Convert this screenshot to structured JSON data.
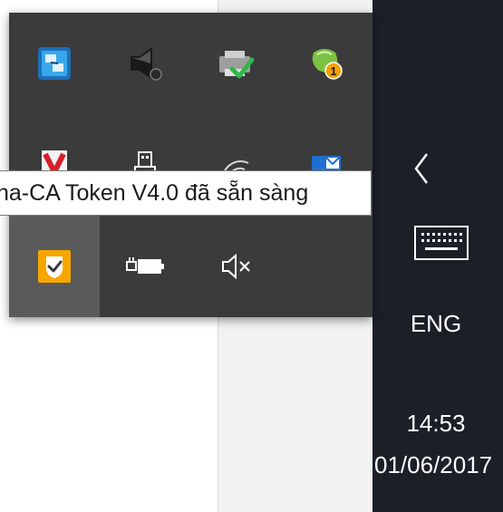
{
  "tooltip": {
    "text": "na-CA Token V4.0 đã sẵn sàng"
  },
  "tray": {
    "icons": [
      {
        "name": "network-monitor-icon",
        "color": "#2a8fd8"
      },
      {
        "name": "speaker-app-icon",
        "color": "#222222"
      },
      {
        "name": "printer-check-icon",
        "color": "#4caf50"
      },
      {
        "name": "notification-badge-icon",
        "badge": "1",
        "color": "#f5a300"
      },
      {
        "name": "antivirus-v-icon",
        "color": "#d81e2c"
      },
      {
        "name": "usb-device-icon",
        "color": "#ffffff"
      },
      {
        "name": "wifi-icon",
        "color": "#ffffff"
      },
      {
        "name": "outlook-icon",
        "color": "#1f6fd0"
      },
      {
        "name": "security-shield-icon",
        "color": "#f5a300"
      },
      {
        "name": "battery-charging-icon",
        "color": "#ffffff"
      },
      {
        "name": "volume-muted-icon",
        "color": "#ffffff"
      }
    ]
  },
  "taskbar": {
    "language": "ENG",
    "time": "14:53",
    "date": "01/06/2017",
    "chevron_icon": "chevron-left-icon",
    "keyboard_icon": "touch-keyboard-icon"
  }
}
